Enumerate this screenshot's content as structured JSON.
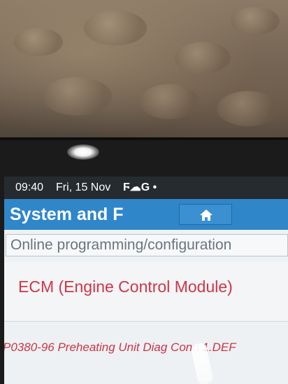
{
  "status_bar": {
    "time": "09:40",
    "date": "Fri, 15 Nov",
    "icons_text": "Ϝ☁G •"
  },
  "header": {
    "title": "System and F",
    "home_icon": "home-icon"
  },
  "path": {
    "text": "Online programming/configuration"
  },
  "list": {
    "module": "ECM (Engine Control Module)",
    "dtc": "P0380-96 Preheating Unit Diag Conn 1.DEF"
  },
  "colors": {
    "header_blue": "#2f86c9",
    "status_bar": "#262b30",
    "item_text_red": "#d0354a"
  }
}
